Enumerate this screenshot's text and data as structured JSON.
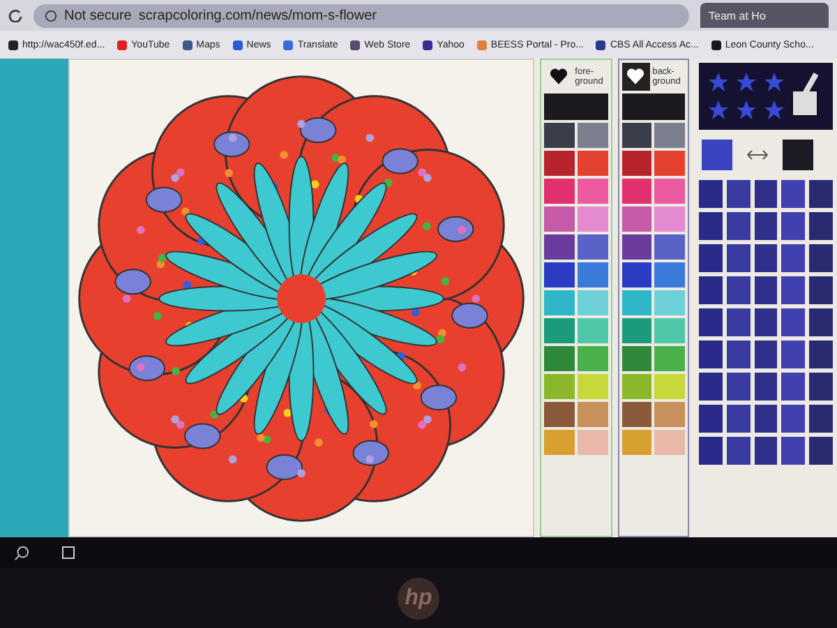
{
  "browser": {
    "security": "Not secure",
    "url": "scrapcoloring.com/news/mom-s-flower",
    "tabs": [
      {
        "title": "Team at Ho"
      }
    ]
  },
  "bookmarks": [
    {
      "label": "http://wac450f.ed...",
      "color": "#222222"
    },
    {
      "label": "YouTube",
      "color": "#e02020"
    },
    {
      "label": "Maps",
      "color": "#3a5a8a"
    },
    {
      "label": "News",
      "color": "#2a5ad8"
    },
    {
      "label": "Translate",
      "color": "#3a6ae0"
    },
    {
      "label": "Web Store",
      "color": "#5a4a6a"
    },
    {
      "label": "Yahoo",
      "color": "#3a2a9a"
    },
    {
      "label": "BEESS Portal - Pro...",
      "color": "#e0803a"
    },
    {
      "label": "CBS All Access Ac...",
      "color": "#2a3a8a"
    },
    {
      "label": "Leon County Scho...",
      "color": "#1a1a1a"
    }
  ],
  "palettes": [
    {
      "label": "fore-ground",
      "selected": false,
      "heart": {
        "color": "#111111"
      },
      "swatches": [
        {
          "color": "#1d1a1f"
        },
        {
          "color": "#3a3d4a"
        },
        {
          "color": "#7c7f8e"
        },
        {
          "color": "#b8242c"
        },
        {
          "color": "#e4412e"
        },
        {
          "color": "#e0306e"
        },
        {
          "color": "#ec5aa0"
        },
        {
          "color": "#c45aa8"
        },
        {
          "color": "#e38ad0"
        },
        {
          "color": "#6a3b9c"
        },
        {
          "color": "#5a62c8"
        },
        {
          "color": "#2a3cc4"
        },
        {
          "color": "#3a7ad8"
        },
        {
          "color": "#2fb6c8"
        },
        {
          "color": "#6ed0d8"
        },
        {
          "color": "#1c9a7c"
        },
        {
          "color": "#4ec8a8"
        },
        {
          "color": "#2e8a3a"
        },
        {
          "color": "#4ab04a"
        },
        {
          "color": "#8ab82a"
        },
        {
          "color": "#c8d83a"
        },
        {
          "color": "#8a5a3a"
        },
        {
          "color": "#c8905a"
        },
        {
          "color": "#d8a030"
        },
        {
          "color": "#e8b8a8"
        }
      ]
    },
    {
      "label": "back-ground",
      "selected": true,
      "heart": {
        "color": "#ffffff"
      },
      "swatches": [
        {
          "color": "#1d1a1f"
        },
        {
          "color": "#3a3d4a"
        },
        {
          "color": "#7c7f8e"
        },
        {
          "color": "#b8242c"
        },
        {
          "color": "#e4412e"
        },
        {
          "color": "#e0306e"
        },
        {
          "color": "#ec5aa0"
        },
        {
          "color": "#c45aa8"
        },
        {
          "color": "#e38ad0"
        },
        {
          "color": "#6a3b9c"
        },
        {
          "color": "#5a62c8"
        },
        {
          "color": "#2a3cc4"
        },
        {
          "color": "#3a7ad8"
        },
        {
          "color": "#2fb6c8"
        },
        {
          "color": "#6ed0d8"
        },
        {
          "color": "#1c9a7c"
        },
        {
          "color": "#4ec8a8"
        },
        {
          "color": "#2e8a3a"
        },
        {
          "color": "#4ab04a"
        },
        {
          "color": "#8ab82a"
        },
        {
          "color": "#c8d83a"
        },
        {
          "color": "#8a5a3a"
        },
        {
          "color": "#c8905a"
        },
        {
          "color": "#d8a030"
        },
        {
          "color": "#e8b8a8"
        }
      ]
    }
  ],
  "current": {
    "foreground": {
      "color": "#3a44c0"
    },
    "background": {
      "color": "#1d1a24"
    }
  },
  "bezel": {
    "logo": "hp"
  }
}
